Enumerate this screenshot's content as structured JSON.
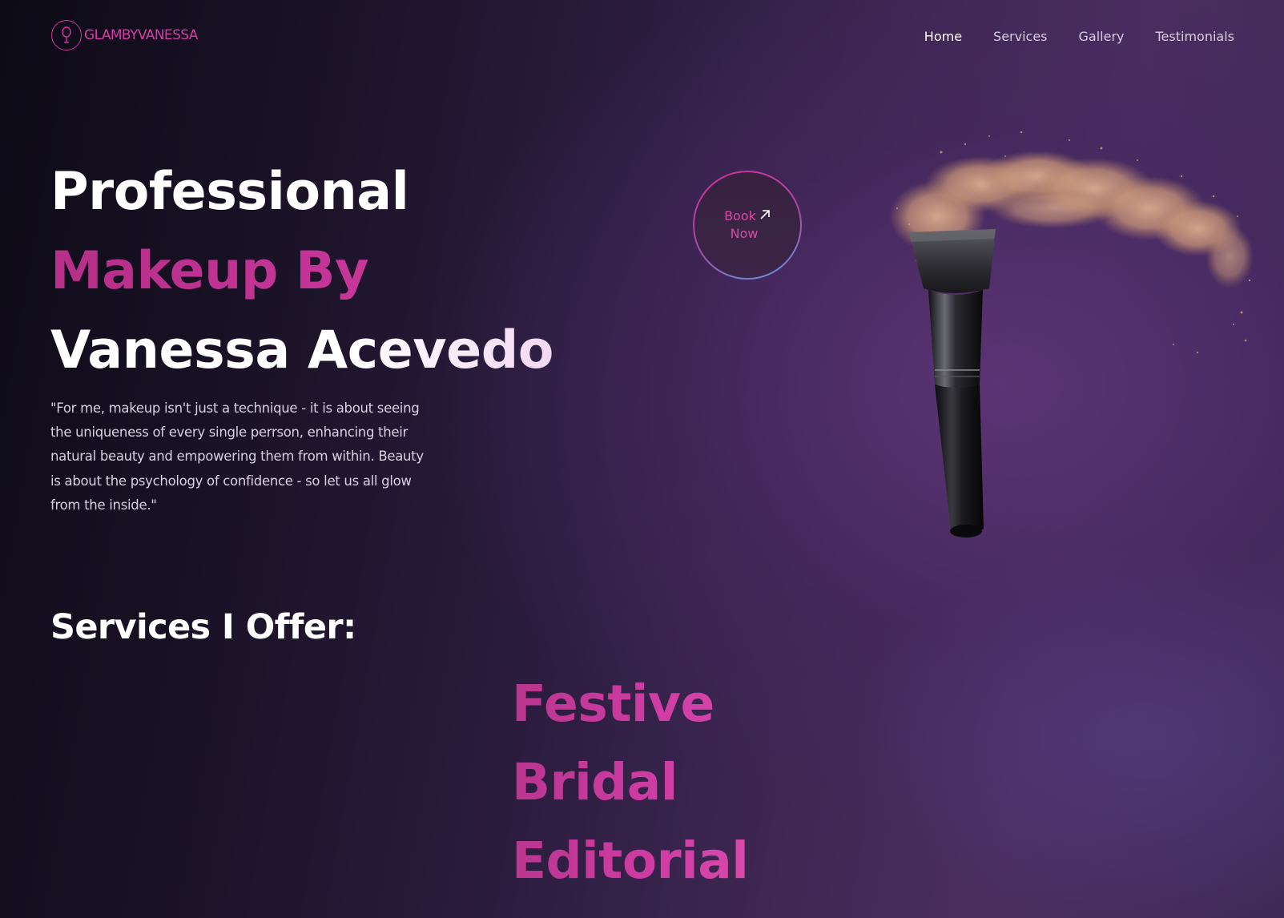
{
  "brand": {
    "logo_text": "GLAMBYVANESSA",
    "logo_icon": "mirror-icon",
    "accent_color": "#d0339a"
  },
  "nav": {
    "items": [
      {
        "label": "Home",
        "active": true
      },
      {
        "label": "Services",
        "active": false
      },
      {
        "label": "Gallery",
        "active": false
      },
      {
        "label": "Testimonials",
        "active": false
      }
    ]
  },
  "hero": {
    "line1": "Professional",
    "line2": "Makeup By",
    "line3": "Vanessa Acevedo",
    "quote": "\"For me, makeup isn't just a technique - it is about seeing the uniqueness of every single perrson, enhancing their natural beauty and empowering them from within. Beauty is about the psychology of confidence - so let us all glow from the inside.\""
  },
  "book_button": {
    "line1": "Book",
    "line2": "Now",
    "icon": "arrow-up-right-icon"
  },
  "illustration": {
    "subject": "makeup-brush-with-powder-splash"
  },
  "services": {
    "heading": "Services I Offer:",
    "items": [
      "Festive",
      "Bridal",
      "Editorial"
    ]
  }
}
